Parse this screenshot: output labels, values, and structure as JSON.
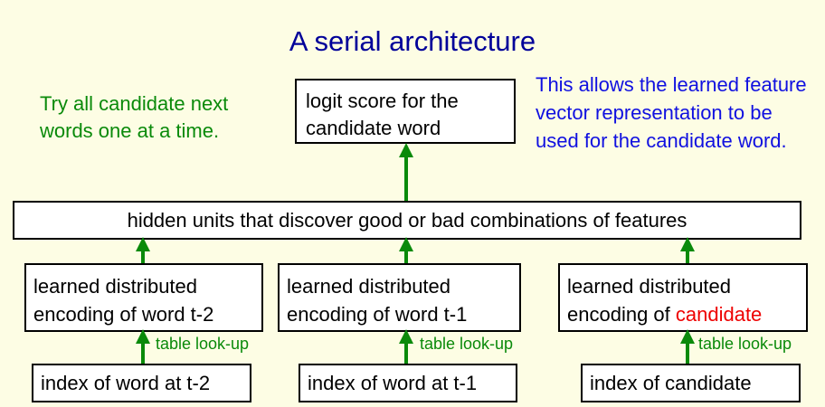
{
  "title": "A serial architecture",
  "note_left": "Try all  candidate next words one at a time.",
  "note_right": "This allows the learned feature vector representation to be used for the candidate word.",
  "logit_box": "logit score for the candidate word",
  "hidden_box": "hidden units that discover good or bad combinations of features",
  "encodings": [
    {
      "text": "learned distributed encoding of word t-2"
    },
    {
      "text": "learned distributed encoding of word t-1"
    },
    {
      "prefix": "learned distributed encoding of ",
      "highlight": "candidate"
    }
  ],
  "lookup_label": "table look-up",
  "indices": [
    "index of word at t-2",
    "index of word at t-1",
    "index of candidate"
  ],
  "colors": {
    "title": "#000099",
    "green": "#0a8a0a",
    "blue": "#1010e0",
    "highlight": "#ee0000",
    "arrow": "#0a8a0a"
  }
}
